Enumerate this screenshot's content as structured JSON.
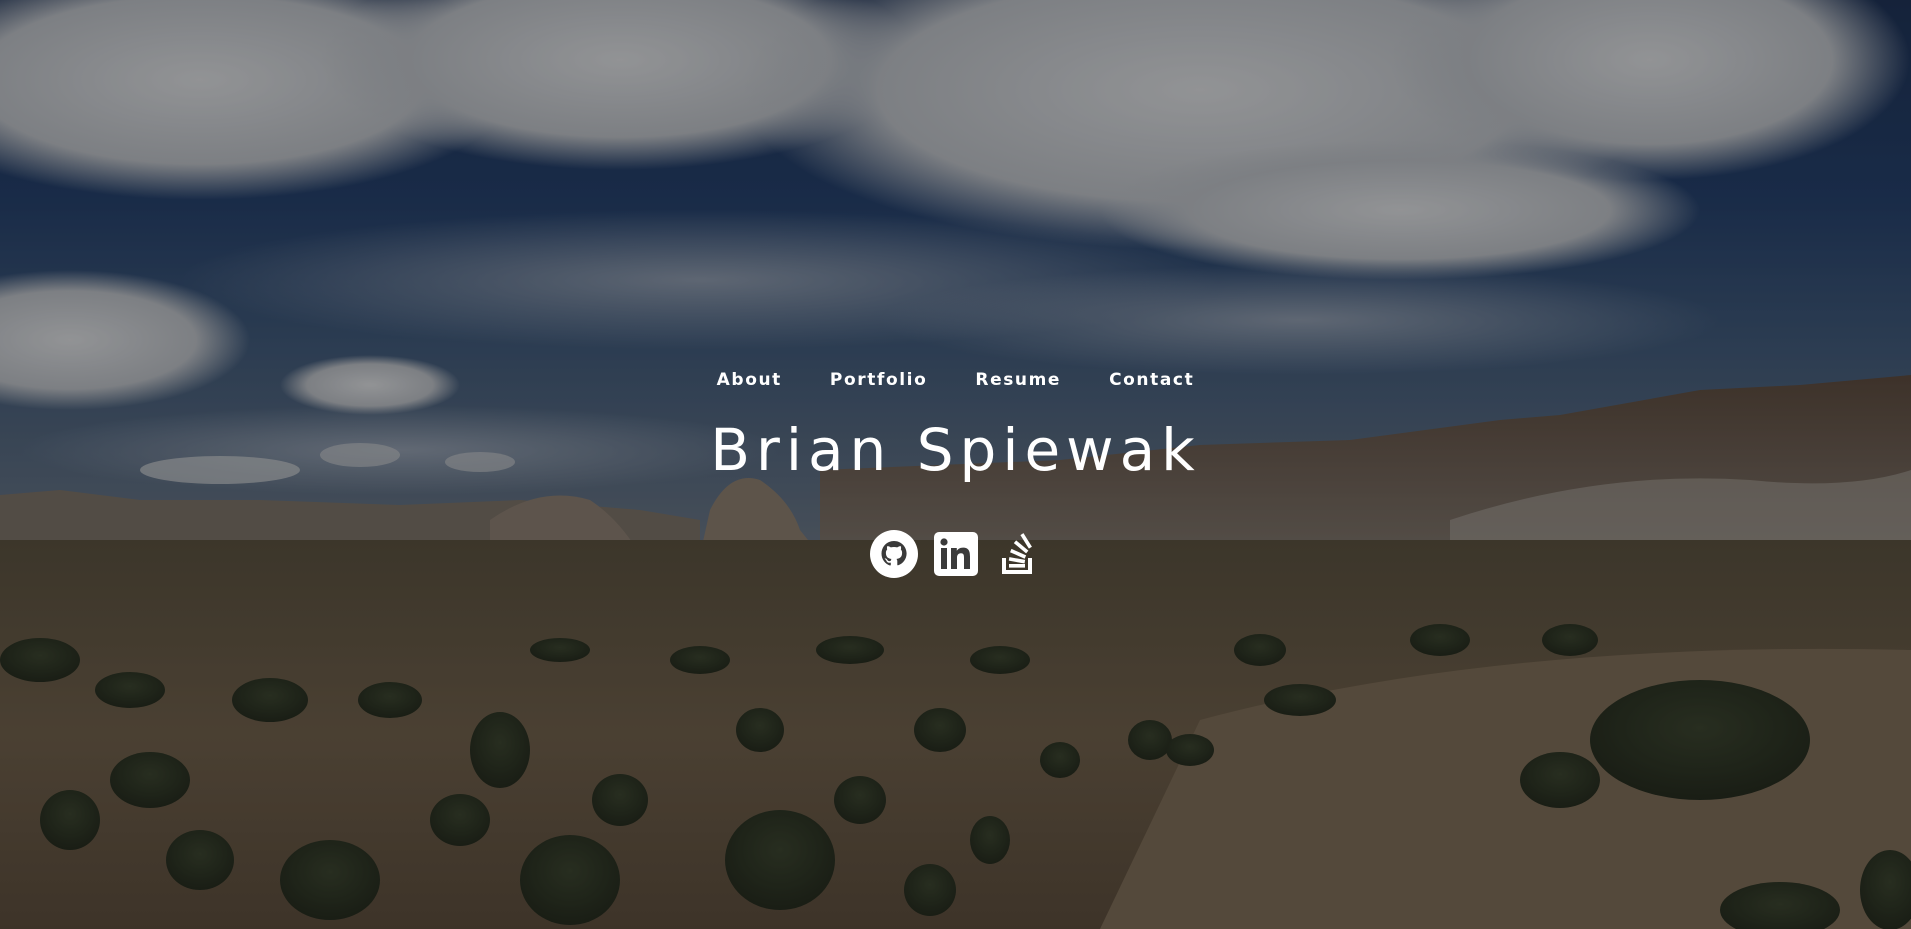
{
  "page": {
    "background_theme": "desert landscape with cloudy blue sky",
    "overlay_color": "#000000"
  },
  "nav": {
    "items": [
      {
        "label": "About"
      },
      {
        "label": "Portfolio"
      },
      {
        "label": "Resume"
      },
      {
        "label": "Contact"
      }
    ]
  },
  "hero": {
    "name": "Brian Spiewak"
  },
  "socials": {
    "items": [
      {
        "icon": "github-icon"
      },
      {
        "icon": "linkedin-icon"
      },
      {
        "icon": "stackoverflow-icon"
      }
    ],
    "color": "#ffffff"
  }
}
